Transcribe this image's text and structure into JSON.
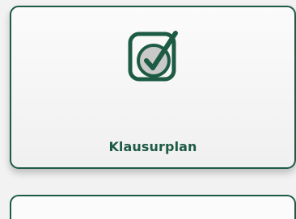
{
  "tile": {
    "label": "Klausurplan",
    "icon": "checkbox-checked-icon",
    "color": "#1e5b45"
  }
}
